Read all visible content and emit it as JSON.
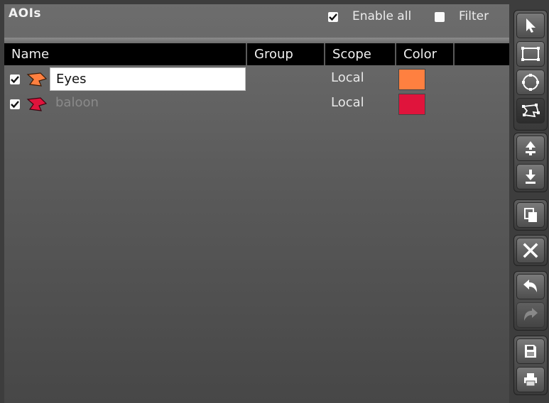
{
  "header": {
    "title": "AOIs",
    "enable_all": {
      "label": "Enable all",
      "checked": true
    },
    "filter": {
      "label": "Filter",
      "checked": false
    }
  },
  "table": {
    "columns": [
      "Name",
      "Group",
      "Scope",
      "Color"
    ],
    "rows": [
      {
        "enabled": true,
        "name": "Eyes",
        "group": "",
        "scope": "Local",
        "color": "#ff8040",
        "editing": true
      },
      {
        "enabled": true,
        "name": "baloon",
        "group": "",
        "scope": "Local",
        "color": "#e0143c",
        "editing": false
      }
    ]
  },
  "toolbar": {
    "tools": [
      "select-arrow-icon",
      "rectangle-icon",
      "ellipse-icon",
      "polygon-icon"
    ],
    "order": [
      "move-up-icon",
      "move-down-icon"
    ],
    "edit": [
      "duplicate-icon",
      "delete-icon",
      "undo-icon",
      "redo-icon",
      "save-icon",
      "print-icon"
    ],
    "active_tool": "polygon-icon"
  }
}
